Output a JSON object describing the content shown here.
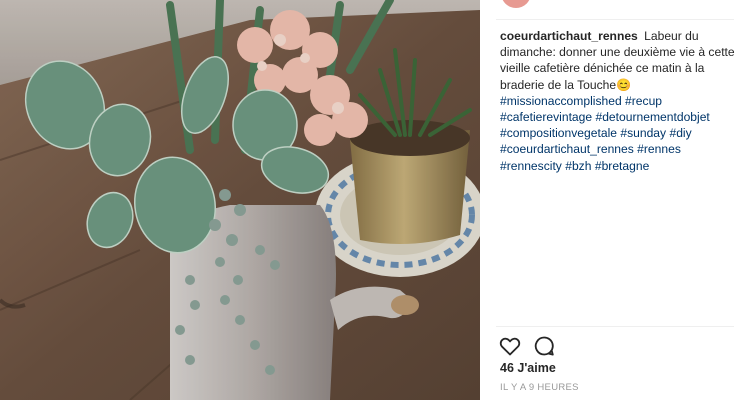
{
  "post": {
    "username": "coeurdartichaut_rennes",
    "caption_text": "Labeur du dimanche: donner une deuxième vie à cette vieille cafetière dénichée ce matin à la braderie de la Touche😊",
    "hashtags": [
      "#missionaccomplished",
      "#recup",
      "#cafetierevintage",
      "#detournementdobjet",
      "#compositionvegetale",
      "#sunday",
      "#diy",
      "#coeurdartichaut_rennes",
      "#rennes",
      "#rennescity",
      "#bzh",
      "#bretagne"
    ],
    "likes": "46 J'aime",
    "timestamp": "IL Y A 9 HEURES"
  },
  "icons": {
    "like": "heart-icon",
    "comment": "comment-bubble-icon"
  },
  "colors": {
    "text": "#262626",
    "hashtag": "#003569",
    "muted": "#999999",
    "avatar": "#e79a92"
  }
}
